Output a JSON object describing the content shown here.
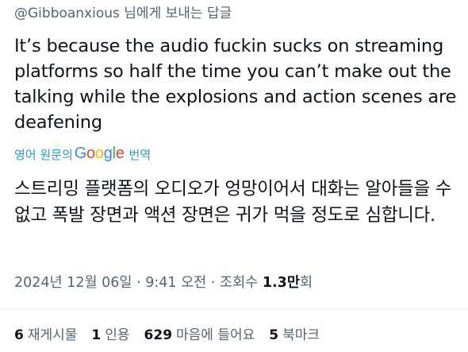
{
  "reply": {
    "handle": "@Gibboanxious",
    "suffix": " 님에게 보내는 답글"
  },
  "tweet": {
    "text": "It’s because the audio fuckin sucks on streaming platforms so half the time you can’t make out the talking while the explosions and action scenes are deafening"
  },
  "translation": {
    "prefix": "영어 원문의",
    "provider_letters": [
      "G",
      "o",
      "o",
      "g",
      "l",
      "e"
    ],
    "suffix": "번역",
    "text": "스트리밍 플랫폼의 오디오가 엉망이어서 대화는 알아들을 수 없고 폭발 장면과 액션 장면은 귀가 먹을 정도로 심합니다."
  },
  "meta": {
    "date": "2024년 12월 06일",
    "sep1": " · ",
    "time": "9:41 오전",
    "sep2": " · ",
    "views_label": "조회수 ",
    "views_number": "1.3만",
    "views_suffix": "회"
  },
  "stats": [
    {
      "count": "6",
      "label": "재게시물"
    },
    {
      "count": "1",
      "label": "인용"
    },
    {
      "count": "629",
      "label": "마음에 들어요"
    },
    {
      "count": "5",
      "label": "북마크"
    }
  ],
  "colors": {
    "text": "#0f1419",
    "secondary": "#536471",
    "link": "#1d9bf0"
  }
}
